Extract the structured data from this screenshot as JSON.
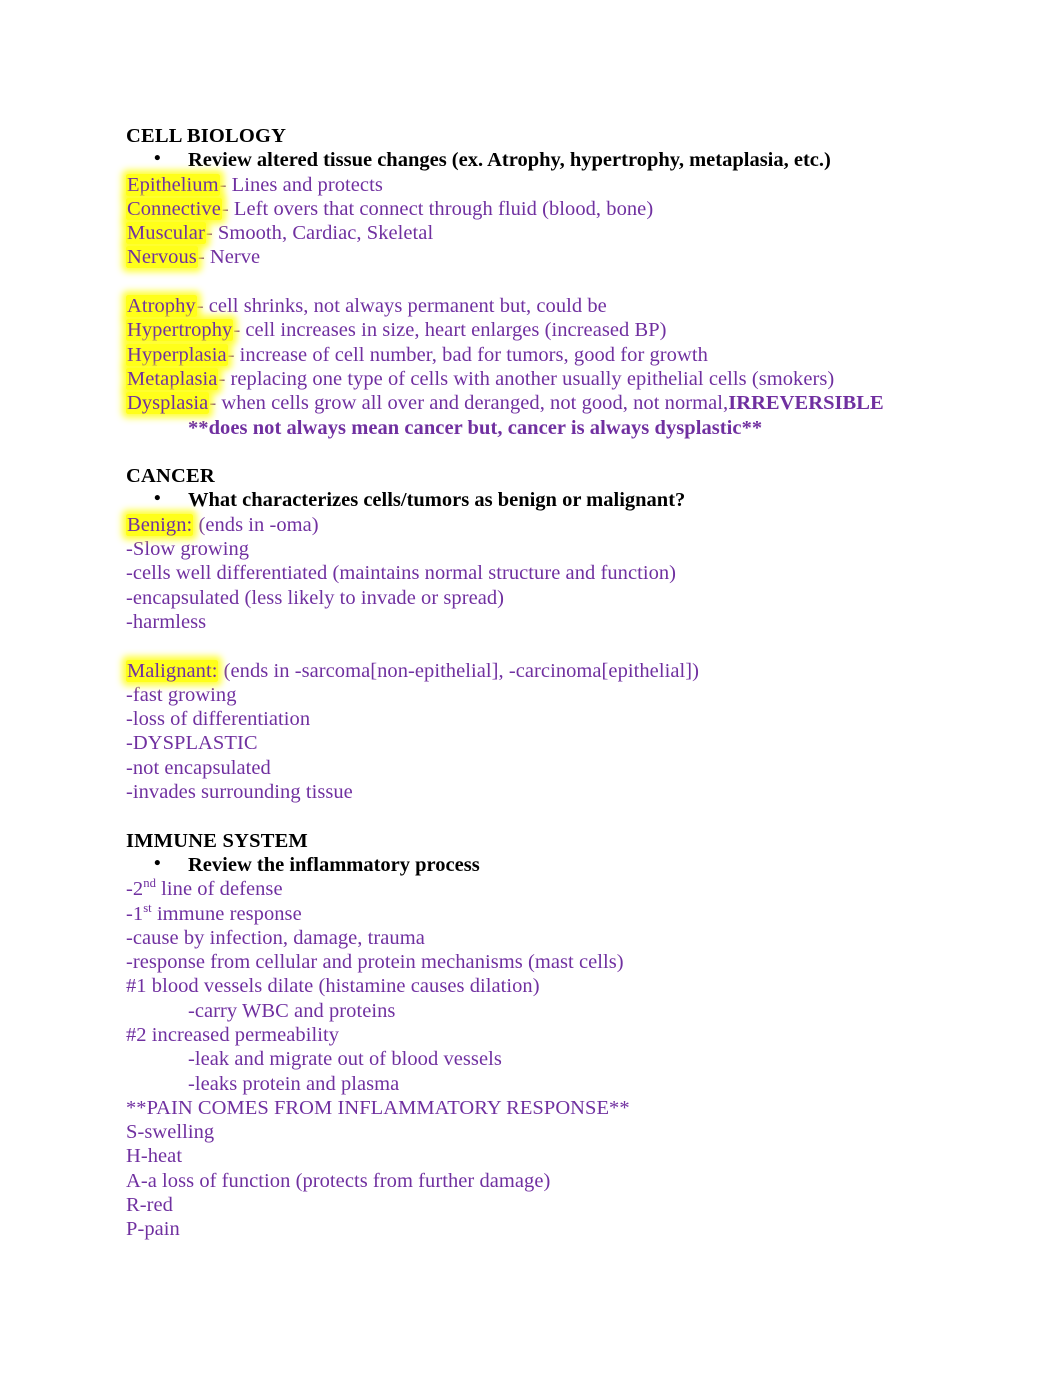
{
  "document": {
    "text_color": "#7030A0",
    "highlight_color": "#FFFF00",
    "heading_color": "#000000",
    "bullet_glyph": "•",
    "sections": [
      {
        "heading": "CELL BIOLOGY",
        "bullet": "Review altered tissue changes (ex. Atrophy, hypertrophy, metaplasia, etc.)",
        "lines": [
          {
            "highlight": "Epithelium",
            "rest": "- Lines and protects"
          },
          {
            "highlight": "Connective",
            "rest": "- Left overs that connect through fluid (blood, bone)"
          },
          {
            "highlight": "Muscular",
            "rest": "- Smooth, Cardiac, Skeletal"
          },
          {
            "highlight": "Nervous",
            "rest": "- Nerve"
          },
          {
            "blank": true
          },
          {
            "highlight": "Atrophy",
            "rest": "- cell shrinks, not always permanent but, could be"
          },
          {
            "highlight": "Hypertrophy",
            "rest": "- cell increases in size, heart enlarges (increased BP)"
          },
          {
            "highlight": "Hyperplasia",
            "rest": "- increase of cell number, bad for tumors, good for growth"
          },
          {
            "highlight": "Metaplasia",
            "rest": "- replacing one type of cells with another usually epithelial cells (smokers)"
          },
          {
            "highlight": "Dysplasia",
            "rest": "- when cells grow all over and deranged, not good, not normal,",
            "bold_tail": "IRREVERSIBLE"
          },
          {
            "indent": 1,
            "bold_purple": "**does not always mean cancer but, cancer is always dysplastic**"
          },
          {
            "blank": true
          }
        ]
      },
      {
        "heading": "CANCER",
        "bullet": "What characterizes cells/tumors as benign or malignant?",
        "lines": [
          {
            "highlight": "Benign:",
            "rest": " (ends in -oma)"
          },
          {
            "rest": "-Slow growing"
          },
          {
            "rest": "-cells well differentiated (maintains normal structure and function)"
          },
          {
            "rest": "-encapsulated (less likely to invade or spread)"
          },
          {
            "rest": "-harmless"
          },
          {
            "blank": true
          },
          {
            "highlight": "Malignant:",
            "rest": " (ends in -sarcoma[non-epithelial], -carcinoma[epithelial])"
          },
          {
            "rest": "-fast growing"
          },
          {
            "rest": "-loss of differentiation"
          },
          {
            "rest": "-DYSPLASTIC"
          },
          {
            "rest": "-not encapsulated"
          },
          {
            "rest": "-invades surrounding tissue"
          },
          {
            "blank": true
          }
        ]
      },
      {
        "heading": "IMMUNE SYSTEM",
        "bullet": "Review the inflammatory process",
        "lines": [
          {
            "prefix": "-2",
            "sup": "nd",
            "rest": " line of defense"
          },
          {
            "prefix": "-1",
            "sup": "st",
            "rest": " immune response"
          },
          {
            "rest": "-cause by infection, damage, trauma"
          },
          {
            "rest": "-response from cellular and protein mechanisms (mast cells)"
          },
          {
            "rest": "#1 blood vessels dilate (histamine causes dilation)"
          },
          {
            "indent": 2,
            "rest": "-carry WBC and proteins"
          },
          {
            "rest": "#2 increased permeability"
          },
          {
            "indent": 2,
            "rest": "-leak and migrate out of blood vessels"
          },
          {
            "indent": 2,
            "rest": "-leaks protein and plasma"
          },
          {
            "rest": "**PAIN COMES FROM INFLAMMATORY RESPONSE**"
          },
          {
            "rest": "S-swelling"
          },
          {
            "rest": "H-heat"
          },
          {
            "rest": "A-a loss of function (protects from further damage)"
          },
          {
            "rest": "R-red"
          },
          {
            "rest": "P-pain"
          }
        ]
      }
    ]
  }
}
